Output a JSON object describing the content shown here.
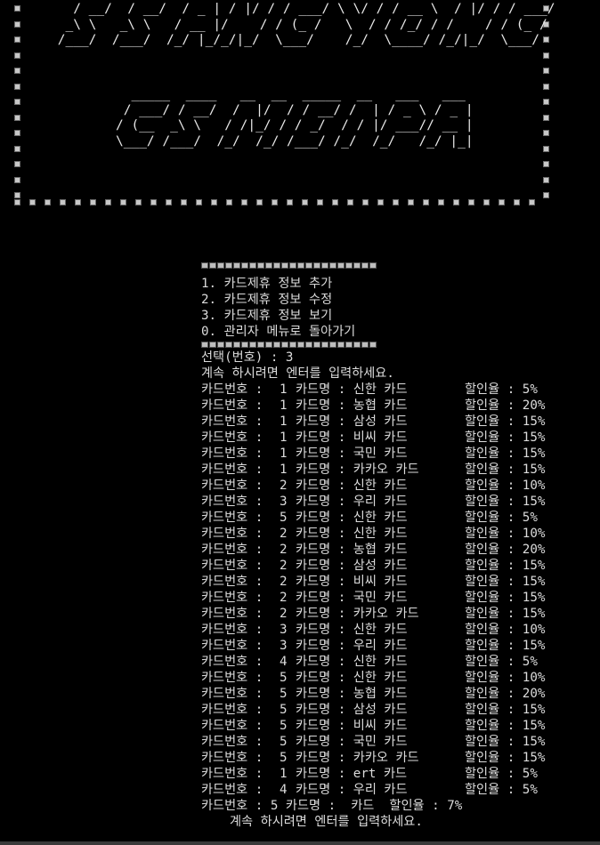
{
  "banner": {
    "title_art": [
      "   / __/  / __/  / _ | / |/ / / ___/ \\ \\/ / / __ \\  / |/ / / ___/",
      "  _\\ \\   _\\ \\   / __ |/    / / (_ /   \\  / / /_/ / /    / / (_ / ",
      " /___/  /___/  /_/ |_/_/|_/  \\___/    /_/  \\____/ /_/|_/  \\___/  "
    ],
    "sub_art": [
      "  _____  ____   __  __  _____  __   ___   ___",
      " / ___/ / __/  /  |/  / / __/ /  | / _ \\ / _ |",
      "/ (__  _\\ \\   / /|_/ / / _/  / / |/ ___// __ |",
      "\\___/ /___/  /_/  /_/ /___/ /_/  /_/   /_/ |_|"
    ]
  },
  "menu": {
    "items": [
      "1. 카드제휴 정보 추가",
      "2. 카드제휴 정보 수정",
      "3. 카드제휴 정보 보기",
      "0. 관리자 메뉴로 돌아가기"
    ],
    "selection_prompt": "선택(번호) : 3",
    "continue_prompt": "계속 하시려면 엔터를 입력하세요."
  },
  "card_rows": [
    {
      "label": "카드번호 :",
      "num": "1",
      "name": "카드명 : 신한 카드",
      "disc": "할인율 : 5%"
    },
    {
      "label": "카드번호 :",
      "num": "1",
      "name": "카드명 : 농협 카드",
      "disc": "할인율 : 20%"
    },
    {
      "label": "카드번호 :",
      "num": "1",
      "name": "카드명 : 삼성 카드",
      "disc": "할인율 : 15%"
    },
    {
      "label": "카드번호 :",
      "num": "1",
      "name": "카드명 : 비씨 카드",
      "disc": "할인율 : 15%"
    },
    {
      "label": "카드번호 :",
      "num": "1",
      "name": "카드명 : 국민 카드",
      "disc": "할인율 : 15%"
    },
    {
      "label": "카드번호 :",
      "num": "1",
      "name": "카드명 : 카카오 카드",
      "disc": "할인율 : 15%"
    },
    {
      "label": "카드번호 :",
      "num": "2",
      "name": "카드명 : 신한 카드",
      "disc": "할인율 : 10%"
    },
    {
      "label": "카드번호 :",
      "num": "3",
      "name": "카드명 : 우리 카드",
      "disc": "할인율 : 15%"
    },
    {
      "label": "카드번호 :",
      "num": "5",
      "name": "카드명 : 신한 카드",
      "disc": "할인율 : 5%"
    },
    {
      "label": "카드번호 :",
      "num": "2",
      "name": "카드명 : 신한 카드",
      "disc": "할인율 : 10%"
    },
    {
      "label": "카드번호 :",
      "num": "2",
      "name": "카드명 : 농협 카드",
      "disc": "할인율 : 20%"
    },
    {
      "label": "카드번호 :",
      "num": "2",
      "name": "카드명 : 삼성 카드",
      "disc": "할인율 : 15%"
    },
    {
      "label": "카드번호 :",
      "num": "2",
      "name": "카드명 : 비씨 카드",
      "disc": "할인율 : 15%"
    },
    {
      "label": "카드번호 :",
      "num": "2",
      "name": "카드명 : 국민 카드",
      "disc": "할인율 : 15%"
    },
    {
      "label": "카드번호 :",
      "num": "2",
      "name": "카드명 : 카카오 카드",
      "disc": "할인율 : 15%"
    },
    {
      "label": "카드번호 :",
      "num": "3",
      "name": "카드명 : 신한 카드",
      "disc": "할인율 : 10%"
    },
    {
      "label": "카드번호 :",
      "num": "3",
      "name": "카드명 : 우리 카드",
      "disc": "할인율 : 15%"
    },
    {
      "label": "카드번호 :",
      "num": "4",
      "name": "카드명 : 신한 카드",
      "disc": "할인율 : 5%"
    },
    {
      "label": "카드번호 :",
      "num": "5",
      "name": "카드명 : 신한 카드",
      "disc": "할인율 : 10%"
    },
    {
      "label": "카드번호 :",
      "num": "5",
      "name": "카드명 : 농협 카드",
      "disc": "할인율 : 20%"
    },
    {
      "label": "카드번호 :",
      "num": "5",
      "name": "카드명 : 삼성 카드",
      "disc": "할인율 : 15%"
    },
    {
      "label": "카드번호 :",
      "num": "5",
      "name": "카드명 : 비씨 카드",
      "disc": "할인율 : 15%"
    },
    {
      "label": "카드번호 :",
      "num": "5",
      "name": "카드명 : 국민 카드",
      "disc": "할인율 : 15%"
    },
    {
      "label": "카드번호 :",
      "num": "5",
      "name": "카드명 : 카카오 카드",
      "disc": "할인율 : 15%"
    },
    {
      "label": "카드번호 :",
      "num": "1",
      "name": "카드명 : ert 카드",
      "disc": "할인율 : 5%"
    },
    {
      "label": "카드번호 :",
      "num": "4",
      "name": "카드명 : 우리 카드",
      "disc": "할인율 : 5%"
    }
  ],
  "last_row": "카드번호 : 5 카드명 :  카드  할인율 : 7%",
  "final_prompt": "계속 하시려면 엔터를 입력하세요.",
  "colors": {
    "background": "#000000",
    "text": "#dcdcdc",
    "border_dot": "#c8c8c8"
  }
}
